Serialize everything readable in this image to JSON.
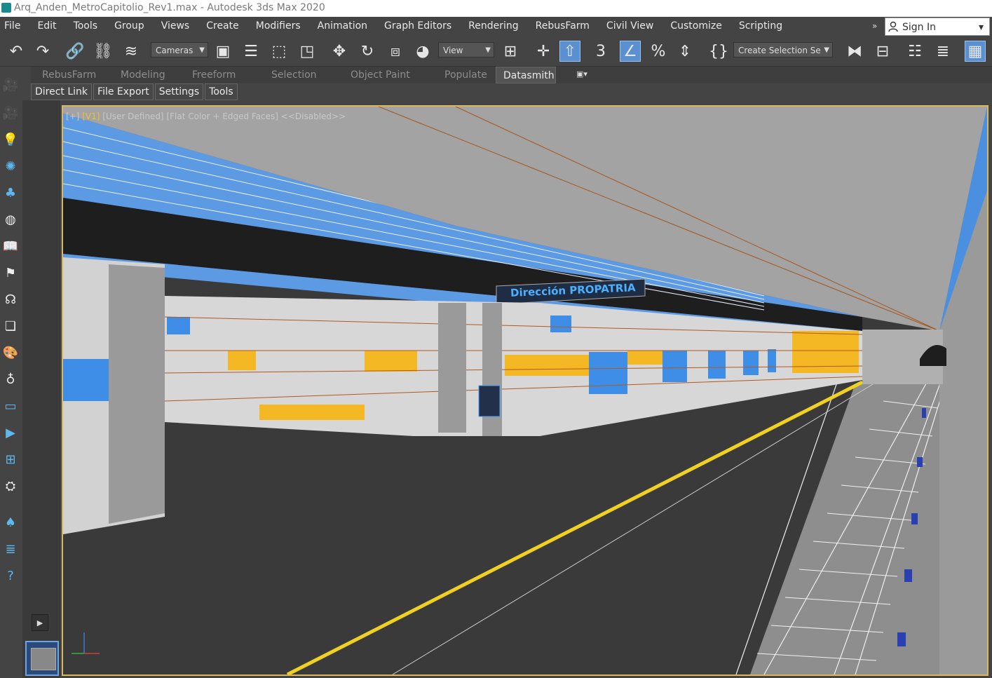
{
  "window": {
    "title": "Arq_Anden_MetroCapitolio_Rev1.max - Autodesk 3ds Max 2020"
  },
  "menu": {
    "items": [
      "File",
      "Edit",
      "Tools",
      "Group",
      "Views",
      "Create",
      "Modifiers",
      "Animation",
      "Graph Editors",
      "Rendering",
      "RebusFarm",
      "Civil View",
      "Customize",
      "Scripting"
    ],
    "more": "»",
    "sign_in": "Sign In"
  },
  "toolbar": {
    "selection_filter": "Cameras",
    "reference_coord": "View",
    "named_selection": "Create Selection Se"
  },
  "ribbon": {
    "tabs": [
      "RebusFarm",
      "Modeling",
      "Freeform",
      "Selection",
      "Object Paint",
      "Populate",
      "Datasmith"
    ],
    "active_tab": "Datasmith",
    "subtabs": [
      "Direct Link",
      "File Export",
      "Settings",
      "Tools"
    ]
  },
  "viewport": {
    "label_plus": "[+]",
    "label_view": "[V1]",
    "label_user": "[User Defined]",
    "label_shading": "[Flat Color + Edged Faces]",
    "label_disabled": "<<Disabled>>",
    "sign_text": "Dirección  PROPATRIA"
  },
  "colors": {
    "accent_blue": "#5a8fd0",
    "viewport_border": "#d8b85a",
    "wall_yellow": "#f4b825",
    "wall_blue": "#3e8ee8"
  }
}
